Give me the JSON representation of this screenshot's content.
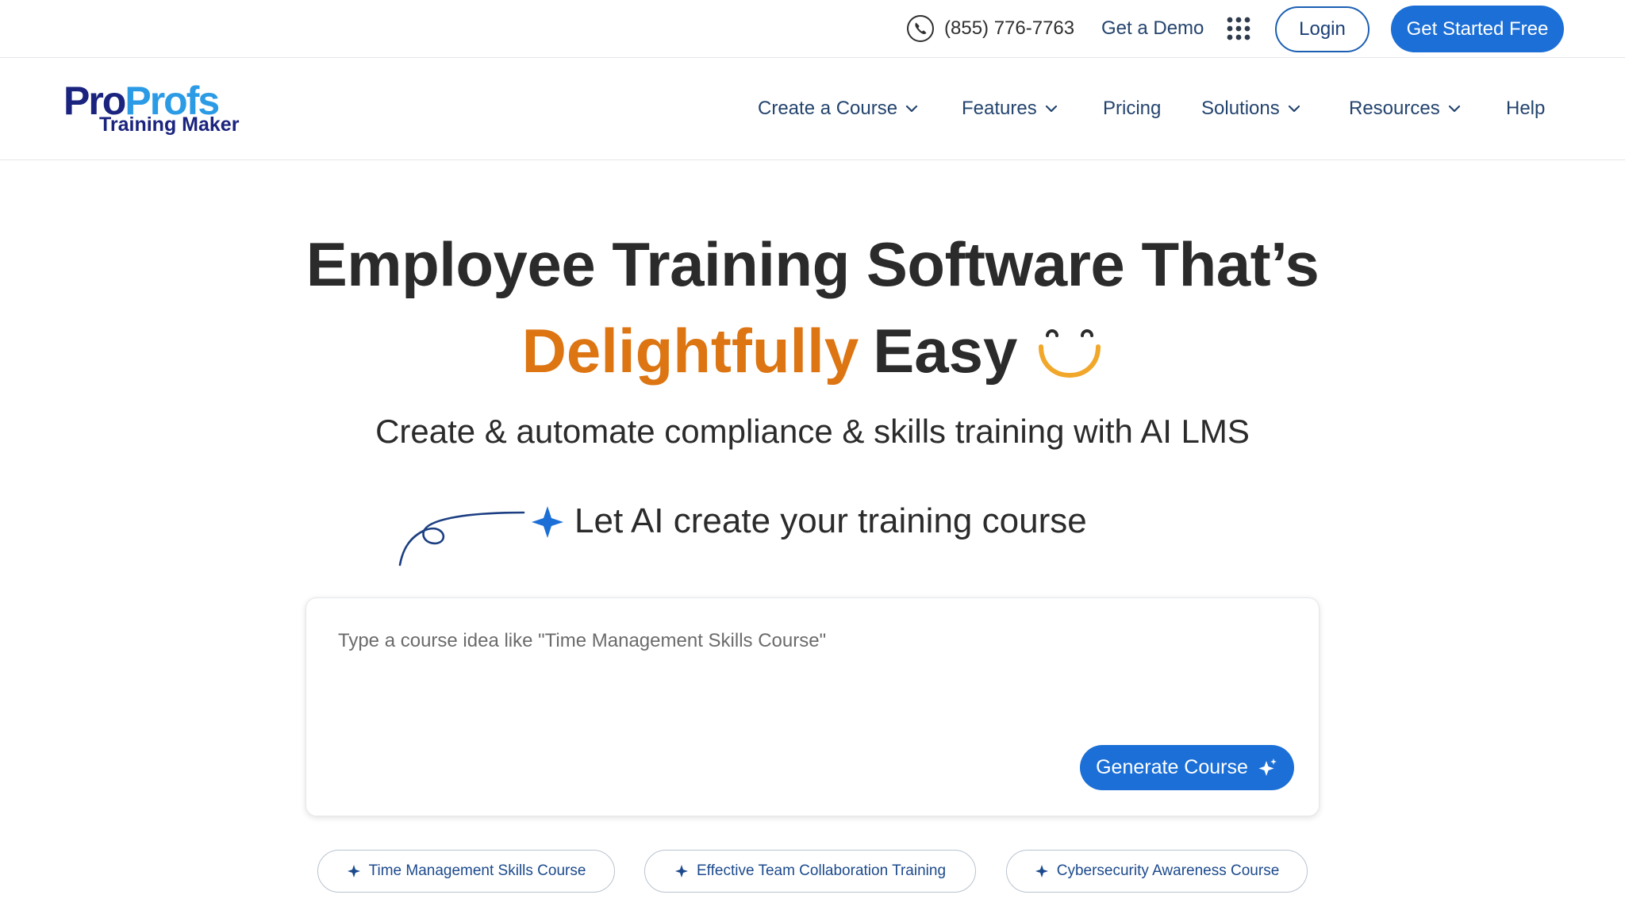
{
  "topbar": {
    "phone": "(855) 776-7763",
    "demo_label": "Get a Demo",
    "login_label": "Login",
    "cta_label": "Get Started Free"
  },
  "logo": {
    "pro": "Pro",
    "profs": "Profs",
    "sub": "Training Maker"
  },
  "nav": {
    "items": [
      {
        "label": "Create a Course",
        "dropdown": true
      },
      {
        "label": "Features",
        "dropdown": true
      },
      {
        "label": "Pricing",
        "dropdown": false
      },
      {
        "label": "Solutions",
        "dropdown": true
      },
      {
        "label": "Resources",
        "dropdown": true
      },
      {
        "label": "Help",
        "dropdown": false
      }
    ]
  },
  "hero": {
    "line1": "Employee Training Software That’s",
    "accent": "Delightfully",
    "line2_rest": "Easy",
    "subhead": "Create & automate compliance & skills training with AI LMS",
    "ai_prompt": "Let AI create your training course"
  },
  "prompt": {
    "placeholder": "Type a course idea like \"Time Management Skills Course\"",
    "generate_label": "Generate Course"
  },
  "suggestions": [
    "Time Management Skills Course",
    "Effective Team Collaboration Training",
    "Cybersecurity Awareness Course"
  ],
  "colors": {
    "primary": "#1b6fd6",
    "accent": "#dc7512",
    "nav_text": "#24446e",
    "logo_dark": "#1a237e",
    "logo_light": "#2b9be6",
    "smiley": "#f0a72a"
  },
  "icons": {
    "phone": "phone-icon",
    "apps": "grid-dots-icon",
    "chevron": "chevron-down-icon",
    "sparkle": "sparkle-icon",
    "smiley": "smiley-icon"
  }
}
